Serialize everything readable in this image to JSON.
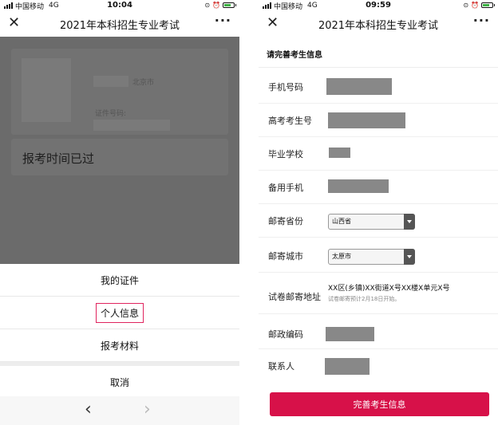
{
  "left_status": {
    "carrier": "中国移动",
    "network": "4G",
    "time": "10:04"
  },
  "right_status": {
    "carrier": "中国移动",
    "network": "4G",
    "time": "09:59"
  },
  "left_nav": {
    "title": "2021年本科招生专业考试",
    "close_icon": "close-icon",
    "more_icon": "more-icon"
  },
  "right_nav": {
    "title": "2021年本科招生专业考试",
    "close_icon": "close-icon",
    "more_icon": "more-icon"
  },
  "left_content": {
    "city": "北京市",
    "id_label": "证件号码:",
    "status_text": "报考时间已过"
  },
  "sheet": {
    "items": [
      {
        "label": "我的证件"
      },
      {
        "label": "个人信息",
        "highlight": true
      },
      {
        "label": "报考材料"
      }
    ],
    "cancel": "取消"
  },
  "browser_bar": {
    "back_icon": "chevron-left-icon",
    "forward_icon": "chevron-right-icon"
  },
  "form": {
    "heading": "请完善考生信息",
    "fields": {
      "phone": "手机号码",
      "exam_no": "高考考生号",
      "school": "毕业学校",
      "backup_phone": "备用手机",
      "province": "邮寄省份",
      "city": "邮寄城市",
      "address": "试卷邮寄地址",
      "postcode": "邮政编码",
      "contact": "联系人"
    },
    "province_value": "山西省",
    "city_value": "太原市",
    "address_value": "XX区(乡镇)XX街道X号XX楼X单元X号",
    "address_note": "试卷邮寄预计2月18日开始。",
    "submit": "完善考生信息"
  },
  "colors": {
    "accent": "#d71149",
    "highlight_border": "#e0245e",
    "overlay": "#6b6b6b"
  }
}
